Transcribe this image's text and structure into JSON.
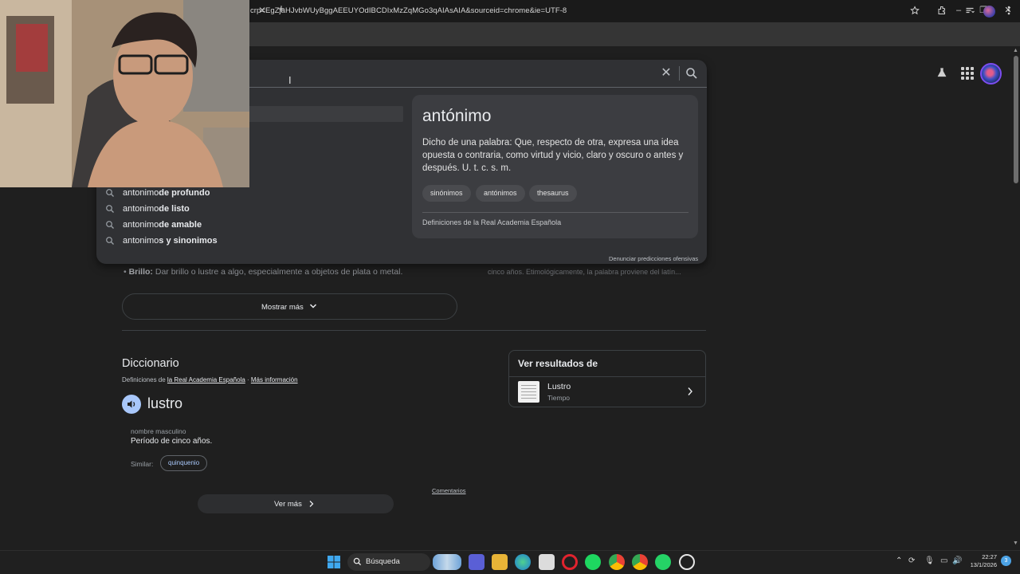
{
  "browser": {
    "url": "crp=EgZjaHJvbWUyBggAEEUYOdIBCDIxMzZqMGo3qAIAsAIA&sourceid=chrome&ie=UTF-8",
    "tab_close": "✕",
    "new_tab": "+",
    "window_controls": {
      "minimize": "–",
      "restore": "❐",
      "close": "✕"
    },
    "icons": [
      "star-icon",
      "extensions-icon",
      "tab-search-icon",
      "profile-icon",
      "menu-icon"
    ]
  },
  "header": {
    "icons": [
      "labs-icon",
      "apps-grid-icon",
      "account-avatar"
    ]
  },
  "search": {
    "clear_icon": "✕",
    "caret": "I",
    "suggestions": [
      {
        "prefix": "antonimo",
        "bold": " de profundo"
      },
      {
        "prefix": "antonimo",
        "bold": " de listo"
      },
      {
        "prefix": "antonimo",
        "bold": " de amable"
      },
      {
        "prefix": "antonimo",
        "bold": "s y sinonimos"
      }
    ],
    "report_label": "Denunciar predicciones ofensivas"
  },
  "definition_card": {
    "word": "antónimo",
    "definition": "Dicho de una palabra: Que, respecto de otra, expresa una idea opuesta o contraria, como virtud y vicio, claro y oscuro o antes y después. U. t. c. s. m.",
    "chips": [
      "sinónimos",
      "antónimos",
      "thesaurus"
    ],
    "source": "Definiciones de la Real Academia Española"
  },
  "page": {
    "bullet": {
      "term": "Brillo:",
      "text": " Dar brillo o lustre a algo, especialmente a objetos de plata o metal."
    },
    "right_snippet": "cinco años. Etimológicamente, la palabra proviene del latín...",
    "show_more": "Mostrar más",
    "dictionary": {
      "title": "Diccionario",
      "source_prefix": "Definiciones de ",
      "source_link": "la Real Academia Española",
      "separator": " · ",
      "more_info": "Más información",
      "word": "lustro",
      "part_of_speech": "nombre masculino",
      "sense": "Período de cinco años.",
      "similar_label": "Similar:",
      "similar_chip": "quinquenio",
      "comments": "Comentarios",
      "see_more": "Ver más"
    },
    "results_panel": {
      "title": "Ver resultados de",
      "item_name": "Lustro",
      "item_sub": "Tiempo"
    }
  },
  "taskbar": {
    "search_label": "Búsqueda",
    "time": "22:27",
    "date": "13/1/2026",
    "notification_count": "3",
    "apps": [
      "windows-start",
      "search",
      "zoom",
      "file-explorer",
      "edge",
      "store",
      "opera",
      "spotify",
      "chrome-profile",
      "chrome",
      "whatsapp",
      "chatgpt"
    ]
  },
  "colors": {
    "accent_blue": "#a8c7fa",
    "page_bg": "#1f1f1f",
    "dropdown_bg": "#303134",
    "card_bg": "#3c3d41"
  }
}
